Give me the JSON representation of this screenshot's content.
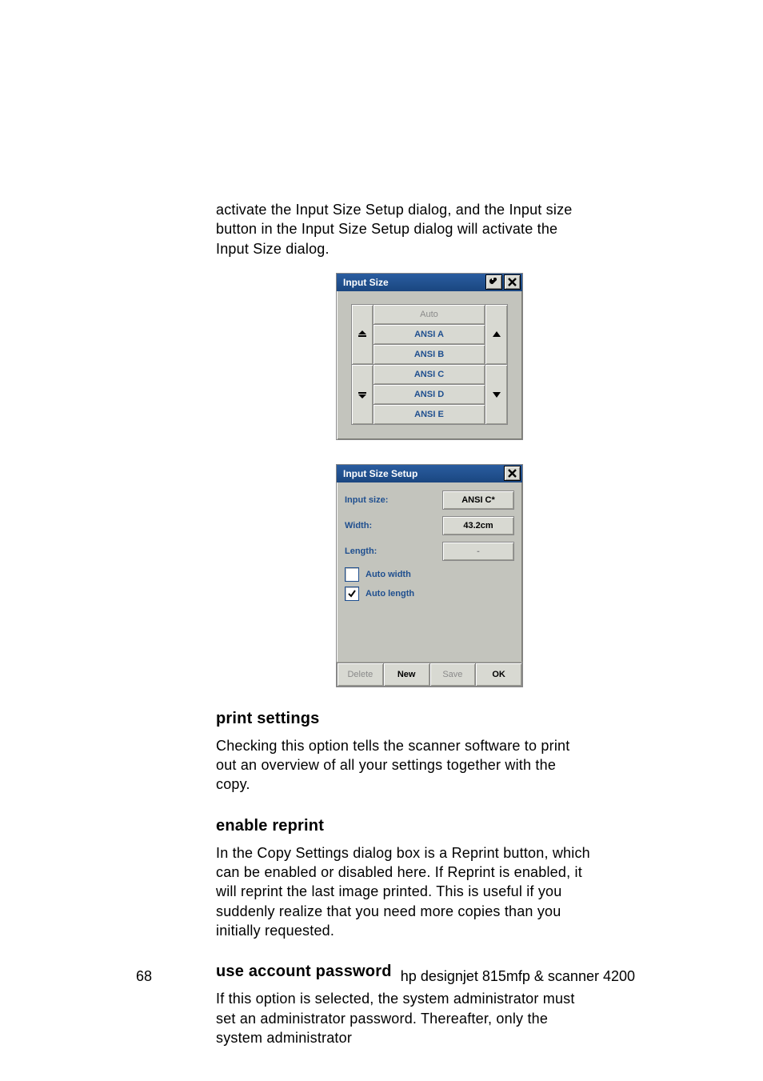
{
  "intro_para": "activate the Input Size Setup dialog, and the Input size button in the Input Size Setup dialog will activate the Input Size dialog.",
  "dlg_size": {
    "title": "Input Size",
    "items": [
      "Auto",
      "ANSI A",
      "ANSI B",
      "ANSI C",
      "ANSI D",
      "ANSI E"
    ],
    "disabled_index": 0
  },
  "dlg_setup": {
    "title": "Input Size Setup",
    "rows": {
      "input_size": {
        "label": "Input size:",
        "value": "ANSI C*"
      },
      "width": {
        "label": "Width:",
        "value": "43.2cm"
      },
      "length": {
        "label": "Length:",
        "value": "-"
      }
    },
    "check_autowidth": {
      "label": "Auto width",
      "checked": false
    },
    "check_autolength": {
      "label": "Auto length",
      "checked": true
    },
    "buttons": {
      "delete": "Delete",
      "new": "New",
      "save": "Save",
      "ok": "OK"
    }
  },
  "sections": {
    "print_settings": {
      "heading": "print settings",
      "para": "Checking this option tells the scanner software to print out an overview of all your settings together with the copy."
    },
    "enable_reprint": {
      "heading": "enable reprint",
      "para": "In the Copy Settings dialog box is a Reprint button, which can be enabled or disabled here. If Reprint is enabled, it will reprint the last image printed. This is useful if you suddenly realize that you need more copies than you initially requested."
    },
    "use_account_password": {
      "heading": "use account password",
      "para": "If this option is selected, the system administrator must set an administrator password. Thereafter, only the system administrator"
    }
  },
  "footer": {
    "page": "68",
    "product": "hp designjet 815mfp & scanner 4200"
  }
}
